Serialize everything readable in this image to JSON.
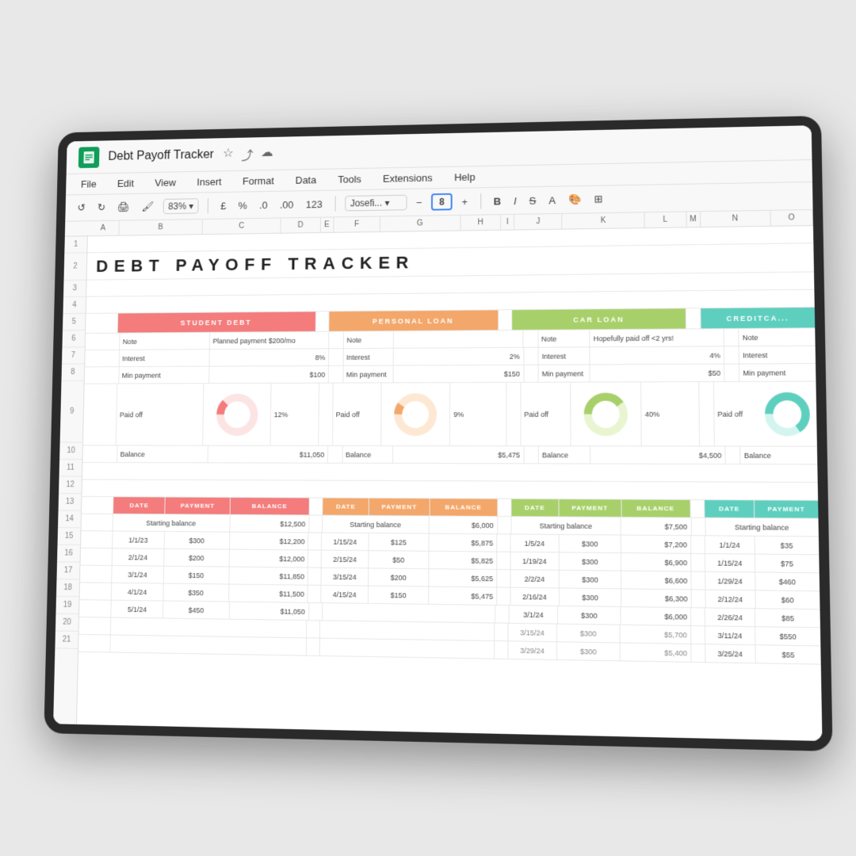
{
  "device": {
    "title": "Debt Payoff Tracker",
    "app": "Google Sheets"
  },
  "menubar": {
    "file": "File",
    "edit": "Edit",
    "view": "View",
    "insert": "Insert",
    "format": "Format",
    "data": "Data",
    "tools": "Tools",
    "extensions": "Extensions",
    "help": "Help"
  },
  "toolbar": {
    "zoom": "83%",
    "font": "Josefi...",
    "fontSize": "8",
    "currency": "£",
    "percent": "%"
  },
  "spreadsheet": {
    "pageTitle": "DEBT PAYOFF TRACKER",
    "columns": [
      "A",
      "B",
      "C",
      "D",
      "E",
      "F",
      "G",
      "H",
      "I",
      "J",
      "K",
      "L",
      "M",
      "N",
      "O"
    ],
    "rows": [
      "1",
      "2",
      "3",
      "4",
      "5",
      "6",
      "7",
      "8",
      "9",
      "10",
      "11",
      "12",
      "13",
      "14",
      "15",
      "16",
      "17",
      "18",
      "19",
      "20",
      "21"
    ],
    "debts": [
      {
        "name": "STUDENT DEBT",
        "color": "student",
        "note": "Planned payment $200/mo",
        "interest": "8%",
        "minPayment": "$100",
        "paidOff": "12%",
        "balance": "$11,050",
        "donutColor": "#f47c7c",
        "donutBg": "#fce4e4",
        "donutPercent": 12
      },
      {
        "name": "PERSONAL LOAN",
        "color": "personal",
        "note": "",
        "interest": "2%",
        "minPayment": "$150",
        "paidOff": "9%",
        "balance": "$5,475",
        "donutColor": "#f4a76a",
        "donutBg": "#fde8d4",
        "donutPercent": 9
      },
      {
        "name": "CAR LOAN",
        "color": "car",
        "note": "Hopefully paid off <2 yrs!",
        "interest": "4%",
        "minPayment": "$50",
        "paidOff": "40%",
        "balance": "$4,500",
        "donutColor": "#a8d06a",
        "donutBg": "#e8f5d0",
        "donutPercent": 40
      },
      {
        "name": "CREDITCA...",
        "color": "credit",
        "note": "",
        "interest": "",
        "minPayment": "",
        "paidOff": "",
        "balance": "",
        "donutColor": "#5ecfbe",
        "donutBg": "#d4f5ef",
        "donutPercent": 65
      }
    ],
    "paymentTables": [
      {
        "debtColor": "student",
        "rows": [
          {
            "date": "Starting balance",
            "payment": "",
            "balance": "$12,500"
          },
          {
            "date": "1/1/23",
            "payment": "$300",
            "balance": "$12,200"
          },
          {
            "date": "2/1/24",
            "payment": "$200",
            "balance": "$12,000"
          },
          {
            "date": "3/1/24",
            "payment": "$150",
            "balance": "$11,850"
          },
          {
            "date": "4/1/24",
            "payment": "$350",
            "balance": "$11,500"
          },
          {
            "date": "5/1/24",
            "payment": "$450",
            "balance": "$11,050"
          }
        ]
      },
      {
        "debtColor": "personal",
        "rows": [
          {
            "date": "Starting balance",
            "payment": "",
            "balance": "$6,000"
          },
          {
            "date": "1/15/24",
            "payment": "$125",
            "balance": "$5,875"
          },
          {
            "date": "2/15/24",
            "payment": "$50",
            "balance": "$5,825"
          },
          {
            "date": "3/15/24",
            "payment": "$200",
            "balance": "$5,625"
          },
          {
            "date": "4/15/24",
            "payment": "$150",
            "balance": "$5,475"
          }
        ]
      },
      {
        "debtColor": "car",
        "rows": [
          {
            "date": "Starting balance",
            "payment": "",
            "balance": "$7,500"
          },
          {
            "date": "1/5/24",
            "payment": "$300",
            "balance": "$7,200"
          },
          {
            "date": "1/19/24",
            "payment": "$300",
            "balance": "$6,900"
          },
          {
            "date": "2/2/24",
            "payment": "$300",
            "balance": "$6,600"
          },
          {
            "date": "2/16/24",
            "payment": "$300",
            "balance": "$6,300"
          },
          {
            "date": "3/1/24",
            "payment": "$300",
            "balance": "$6,000"
          },
          {
            "date": "3/15/24",
            "payment": "$300",
            "balance": "$5,700"
          },
          {
            "date": "3/29/24",
            "payment": "$300",
            "balance": "$5,400"
          }
        ]
      },
      {
        "debtColor": "credit",
        "rows": [
          {
            "date": "Starting balance",
            "payment": "",
            "balance": ""
          },
          {
            "date": "1/1/24",
            "payment": "$35",
            "balance": ""
          },
          {
            "date": "1/15/24",
            "payment": "$75",
            "balance": ""
          },
          {
            "date": "1/29/24",
            "payment": "$460",
            "balance": ""
          },
          {
            "date": "2/12/24",
            "payment": "$60",
            "balance": ""
          },
          {
            "date": "2/26/24",
            "payment": "$85",
            "balance": ""
          },
          {
            "date": "3/11/24",
            "payment": "$550",
            "balance": ""
          },
          {
            "date": "3/25/24",
            "payment": "$55",
            "balance": ""
          }
        ]
      }
    ]
  }
}
